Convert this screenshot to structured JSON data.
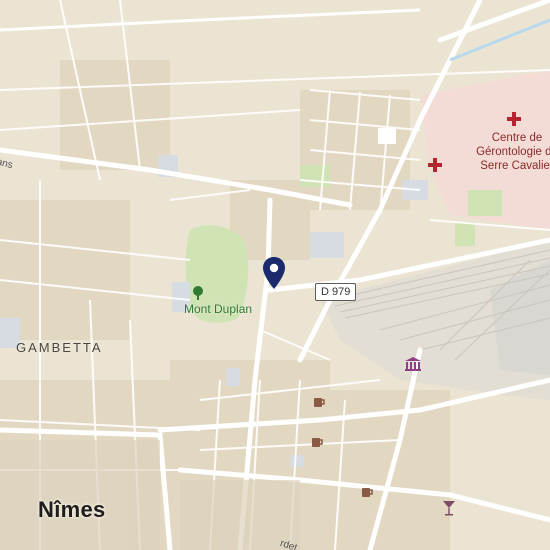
{
  "map": {
    "city_label": "Nîmes",
    "district_label": "GAMBETTA",
    "park_label": "Mont Duplan",
    "hospital_label": "Centre de Gérontologie de Serre Cavalier",
    "road_shield": "D 979",
    "street_label_1": "ians",
    "street_label_2": "rdet",
    "colors": {
      "land": "#ece4d2",
      "block": "#e2d8c2",
      "park": "#cfe3b4",
      "hospital_area": "#f4dcd6",
      "rail": "#c9c5bd",
      "road": "#ffffff",
      "major_road": "#ffffff",
      "pin": "#1a2a6c",
      "hospital_icon": "#b3262f",
      "museum_icon": "#8e3f86",
      "cafe_icon": "#8a5a44",
      "bar_icon": "#7b4b63"
    },
    "icons": [
      "location-pin-icon",
      "tree-icon",
      "hospital-icon",
      "museum-icon",
      "cafe-icon",
      "bar-icon"
    ]
  }
}
